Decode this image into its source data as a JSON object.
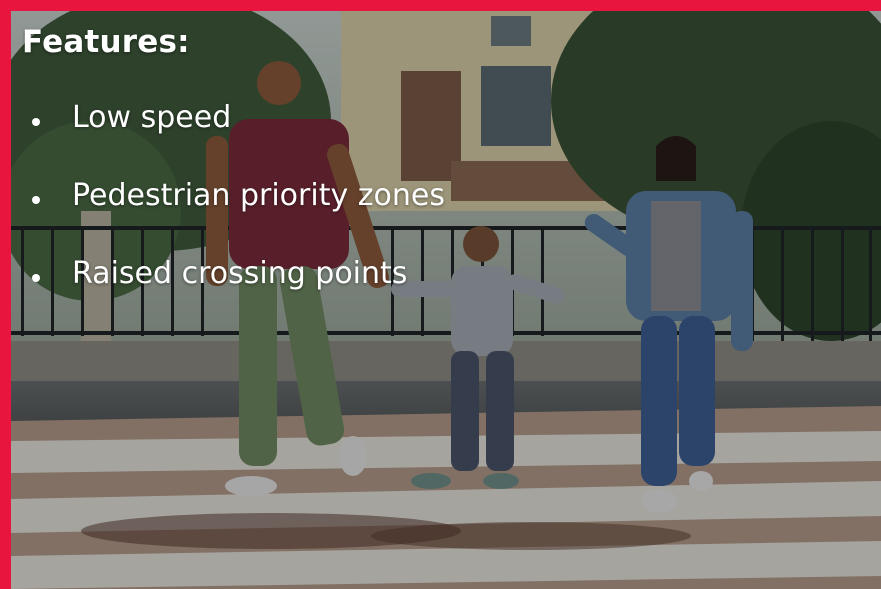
{
  "slide": {
    "title": "Features:",
    "bullets": [
      "Low speed",
      "Pedestrian priority zones",
      "Raised crossing points"
    ]
  },
  "colors": {
    "frame": "#e8163f",
    "text": "#ffffff"
  }
}
